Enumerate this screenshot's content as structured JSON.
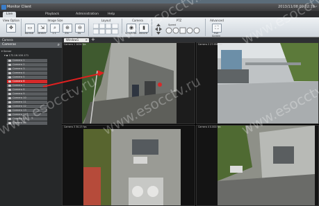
{
  "app": {
    "title": "Monitor Client",
    "clock": "2013/11/08 09:02:19"
  },
  "tabs": [
    "Live",
    "Playback",
    "Administration",
    "Help"
  ],
  "ribbon": {
    "groups": [
      {
        "title": "View Option",
        "buttons": [
          {
            "label": "Full",
            "icon": "fullscreen-icon"
          }
        ]
      },
      {
        "title": "Image Size",
        "buttons": [
          {
            "label": "Normal",
            "icon": "monitor-icon"
          },
          {
            "label": "Stretch",
            "icon": "stretch-icon"
          },
          {
            "label": "1:1",
            "icon": "actual-size-icon"
          },
          {
            "label": "Zin",
            "icon": "zoom-in-icon"
          },
          {
            "label": "Zo",
            "icon": "zoom-out-icon"
          }
        ]
      },
      {
        "title": "Layout",
        "buttons": [
          {
            "label": "",
            "icon": "layout-grid-icon"
          }
        ]
      },
      {
        "title": "Camera",
        "buttons": [
          {
            "label": "Snapshot",
            "icon": "camera-icon"
          },
          {
            "label": "Record",
            "icon": "record-icon"
          }
        ]
      },
      {
        "title": "PTZ",
        "buttons": [
          {
            "label": "Speed",
            "icon": "ptz-icon"
          }
        ]
      },
      {
        "title": "Advanced",
        "buttons": [
          {
            "label": "Full Screen",
            "icon": "fullscreen-icon"
          }
        ]
      }
    ]
  },
  "sidebar": {
    "header": "Camera",
    "title": "Cameras",
    "server": "Server",
    "device": "172.16.100.171",
    "cameras": [
      "Camera 1",
      "Camera 2",
      "Camera 3",
      "Camera 4",
      "Camera 5",
      "Camera 6",
      "Camera 7",
      "Camera 8",
      "Camera 9",
      "Camera 10",
      "Camera 11",
      "Camera 12",
      "Camera 13",
      "Camera 14",
      "Camera 15",
      "Camera 16"
    ],
    "selected_index": 5
  },
  "view_tab": {
    "label": "Window1",
    "add": "+"
  },
  "panes": [
    {
      "label": "Camera 1   1024 fps"
    },
    {
      "label": "Camera 2   27.986 fps"
    },
    {
      "label": "Camera 3   30.23 fps"
    },
    {
      "label": "Camera 4   0.000 fps"
    }
  ],
  "watermark": "www.esocctv.ru",
  "colors": {
    "selection": "#d62a2a",
    "arrow": "#e02020"
  }
}
